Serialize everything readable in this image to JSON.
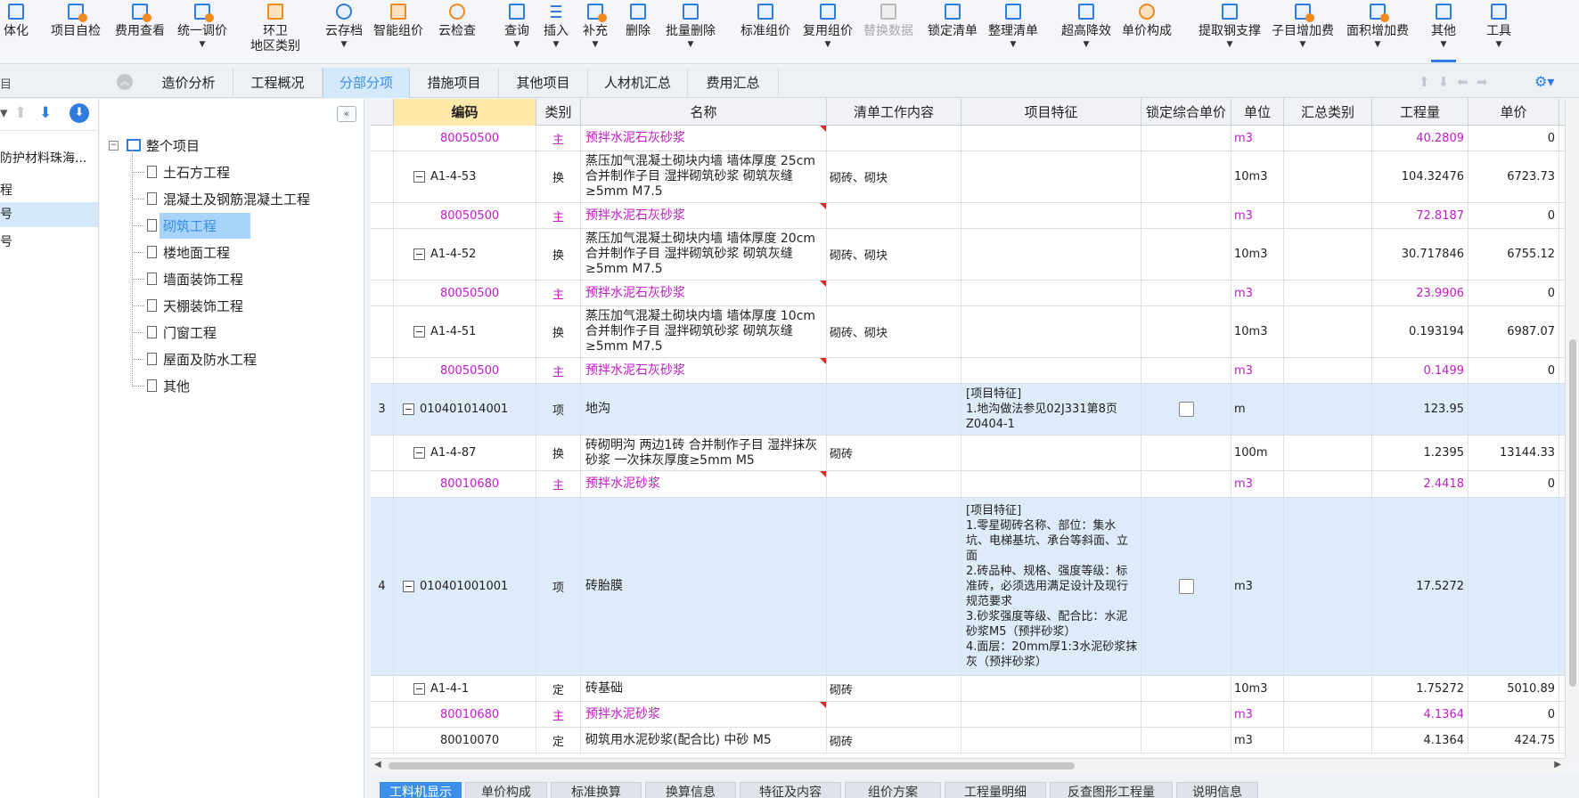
{
  "toolbar": {
    "items": [
      {
        "label": "体化"
      },
      {
        "label": "项目自检"
      },
      {
        "label": "费用查看"
      },
      {
        "label": "统一调价"
      },
      {
        "label": "环卫",
        "label2": "地区类别"
      },
      {
        "label": "云存档"
      },
      {
        "label": "智能组价"
      },
      {
        "label": "云检查"
      },
      {
        "label": "查询"
      },
      {
        "label": "插入"
      },
      {
        "label": "补充"
      },
      {
        "label": "删除"
      },
      {
        "label": "批量删除"
      },
      {
        "label": "标准组价"
      },
      {
        "label": "复用组价"
      },
      {
        "label": "替换数据"
      },
      {
        "label": "锁定清单"
      },
      {
        "label": "整理清单"
      },
      {
        "label": "超高降效"
      },
      {
        "label": "单价构成"
      },
      {
        "label": "提取钢支撑"
      },
      {
        "label": "子目增加费"
      },
      {
        "label": "面积增加费"
      },
      {
        "label": "其他"
      },
      {
        "label": "工具"
      }
    ]
  },
  "tabs": {
    "left_stub": "目",
    "items": [
      {
        "label": "造价分析"
      },
      {
        "label": "工程概况"
      },
      {
        "label": "分部分项"
      },
      {
        "label": "措施项目"
      },
      {
        "label": "其他项目"
      },
      {
        "label": "人材机汇总"
      },
      {
        "label": "费用汇总"
      }
    ]
  },
  "panel_a": {
    "items": [
      {
        "label": "防护材料珠海..."
      },
      {
        "label": "程"
      },
      {
        "label": "号"
      },
      {
        "label": "号"
      }
    ]
  },
  "tree": {
    "root": "整个项目",
    "items": [
      {
        "label": "土石方工程"
      },
      {
        "label": "混凝土及钢筋混凝土工程"
      },
      {
        "label": "砌筑工程"
      },
      {
        "label": "楼地面工程"
      },
      {
        "label": "墙面装饰工程"
      },
      {
        "label": "天棚装饰工程"
      },
      {
        "label": "门窗工程"
      },
      {
        "label": "屋面及防水工程"
      },
      {
        "label": "其他"
      }
    ]
  },
  "grid": {
    "headers": {
      "code": "编码",
      "type": "类别",
      "name": "名称",
      "content": "清单工作内容",
      "feature": "项目特征",
      "lock": "锁定综合单价",
      "unit": "单位",
      "summary": "汇总类别",
      "qty": "工程量",
      "price": "单价"
    },
    "rows": [
      {
        "seq": "",
        "code": "80050500",
        "type": "主",
        "name": "预拌水泥石灰砂浆",
        "content": "",
        "feature": "",
        "unit": "m3",
        "qty": "40.2809",
        "price": "0"
      },
      {
        "seq": "",
        "code": "A1-4-53",
        "type": "换",
        "name": "蒸压加气混凝土砌块内墙 墙体厚度 25cm 合并制作子目 湿拌砌筑砂浆 砌筑灰缝≥5mm M7.5",
        "content": "砌砖、砌块",
        "feature": "",
        "unit": "10m3",
        "qty": "104.32476",
        "price": "6723.73"
      },
      {
        "seq": "",
        "code": "80050500",
        "type": "主",
        "name": "预拌水泥石灰砂浆",
        "content": "",
        "feature": "",
        "unit": "m3",
        "qty": "72.8187",
        "price": "0"
      },
      {
        "seq": "",
        "code": "A1-4-52",
        "type": "换",
        "name": "蒸压加气混凝土砌块内墙 墙体厚度 20cm 合并制作子目 湿拌砌筑砂浆 砌筑灰缝≥5mm M7.5",
        "content": "砌砖、砌块",
        "feature": "",
        "unit": "10m3",
        "qty": "30.717846",
        "price": "6755.12"
      },
      {
        "seq": "",
        "code": "80050500",
        "type": "主",
        "name": "预拌水泥石灰砂浆",
        "content": "",
        "feature": "",
        "unit": "m3",
        "qty": "23.9906",
        "price": "0"
      },
      {
        "seq": "",
        "code": "A1-4-51",
        "type": "换",
        "name": "蒸压加气混凝土砌块内墙 墙体厚度 10cm 合并制作子目 湿拌砌筑砂浆 砌筑灰缝≥5mm M7.5",
        "content": "砌砖、砌块",
        "feature": "",
        "unit": "10m3",
        "qty": "0.193194",
        "price": "6987.07"
      },
      {
        "seq": "",
        "code": "80050500",
        "type": "主",
        "name": "预拌水泥石灰砂浆",
        "content": "",
        "feature": "",
        "unit": "m3",
        "qty": "0.1499",
        "price": "0"
      },
      {
        "seq": "3",
        "code": "010401014001",
        "type": "项",
        "name": "地沟",
        "content": "",
        "feature": "[项目特征]\n1.地沟做法参见02J331第8页Z0404-1",
        "unit": "m",
        "qty": "123.95",
        "price": ""
      },
      {
        "seq": "",
        "code": "A1-4-87",
        "type": "换",
        "name": "砖砌明沟 两边1砖 合并制作子目 湿拌抹灰砂浆 一次抹灰厚度≥5mm M5",
        "content": "砌砖",
        "feature": "",
        "unit": "100m",
        "qty": "1.2395",
        "price": "13144.33"
      },
      {
        "seq": "",
        "code": "80010680",
        "type": "主",
        "name": "预拌水泥砂浆",
        "content": "",
        "feature": "",
        "unit": "m3",
        "qty": "2.4418",
        "price": "0"
      },
      {
        "seq": "4",
        "code": "010401001001",
        "type": "项",
        "name": "砖胎膜",
        "content": "",
        "feature": "[项目特征]\n1.零星砌砖名称、部位：集水坑、电梯基坑、承台等斜面、立面\n2.砖品种、规格、强度等级：标准砖，必须选用满足设计及现行规范要求\n3.砂浆强度等级、配合比：水泥砂浆M5（预拌砂浆）\n4.面层：20mm厚1:3水泥砂浆抹灰（预拌砂浆）",
        "unit": "m3",
        "qty": "17.5272",
        "price": ""
      },
      {
        "seq": "",
        "code": "A1-4-1",
        "type": "定",
        "name": "砖基础",
        "content": "砌砖",
        "feature": "",
        "unit": "10m3",
        "qty": "1.75272",
        "price": "5010.89"
      },
      {
        "seq": "",
        "code": "80010680",
        "type": "主",
        "name": "预拌水泥砂浆",
        "content": "",
        "feature": "",
        "unit": "m3",
        "qty": "4.1364",
        "price": "0"
      },
      {
        "seq": "",
        "code": "80010070",
        "type": "定",
        "name": "砌筑用水泥砂浆(配合比) 中砂 M5",
        "content": "砌砖",
        "feature": "",
        "unit": "m3",
        "qty": "4.1364",
        "price": "424.75"
      }
    ]
  },
  "bottom_tabs": [
    {
      "label": "工料机显示"
    },
    {
      "label": "单价构成"
    },
    {
      "label": "标准换算"
    },
    {
      "label": "换算信息"
    },
    {
      "label": "特征及内容"
    },
    {
      "label": "组价方案"
    },
    {
      "label": "工程量明细"
    },
    {
      "label": "反查图形工程量"
    },
    {
      "label": "说明信息"
    }
  ],
  "colors": {
    "accent": "#2f7ce0",
    "magenta": "#c01cc8",
    "item_row": "#deebf9",
    "active_tab": "#3b8fea"
  }
}
